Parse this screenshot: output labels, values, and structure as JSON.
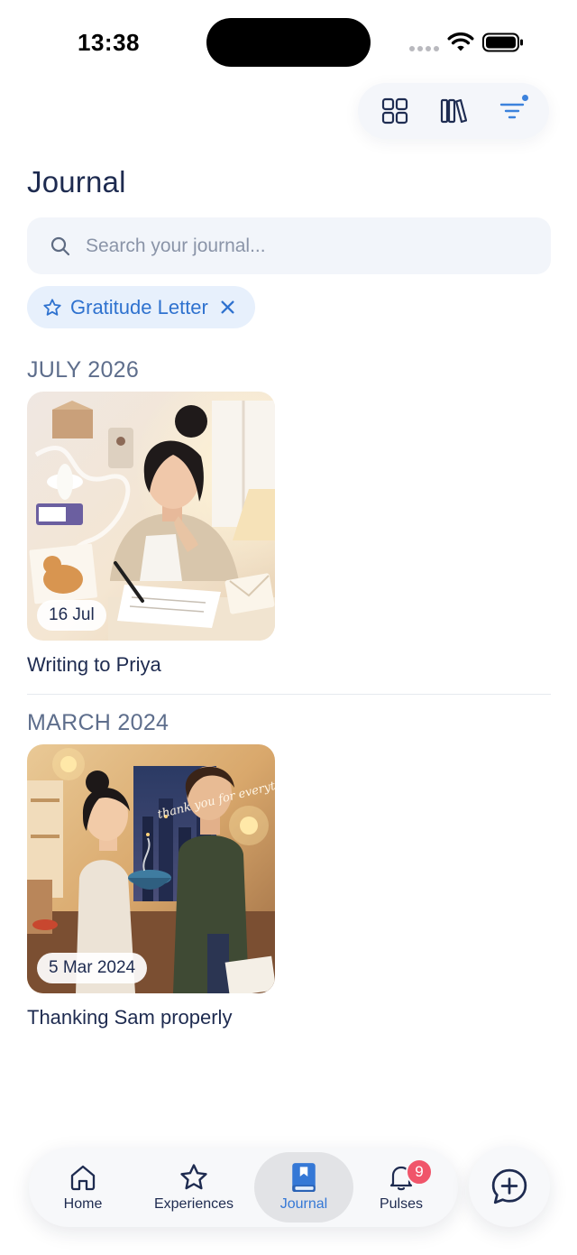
{
  "status_bar": {
    "time": "13:38"
  },
  "header": {
    "title": "Journal"
  },
  "toolbar": {
    "icons": [
      "grid-view-icon",
      "library-icon",
      "filter-icon"
    ],
    "filter_active": true,
    "accent": "#3c82dc"
  },
  "search": {
    "placeholder": "Search your journal..."
  },
  "active_filter": {
    "label": "Gratitude Letter",
    "icon": "star-icon"
  },
  "sections": [
    {
      "heading": "JULY 2026",
      "entries": [
        {
          "date": "16 Jul",
          "title": "Writing to Priya"
        }
      ]
    },
    {
      "heading": "MARCH 2024",
      "entries": [
        {
          "date": "5 Mar 2024",
          "title": "Thanking Sam properly",
          "art_text": "thank you for everything"
        }
      ]
    }
  ],
  "nav": {
    "items": [
      {
        "label": "Home",
        "icon": "home-icon"
      },
      {
        "label": "Experiences",
        "icon": "star-icon"
      },
      {
        "label": "Journal",
        "icon": "journal-book-icon",
        "active": true
      },
      {
        "label": "Pulses",
        "icon": "bell-icon",
        "badge": "9"
      }
    ],
    "active_color": "#3578d6",
    "badge_color": "#f0556a"
  },
  "add_button": {
    "icon": "add-entry-icon"
  }
}
